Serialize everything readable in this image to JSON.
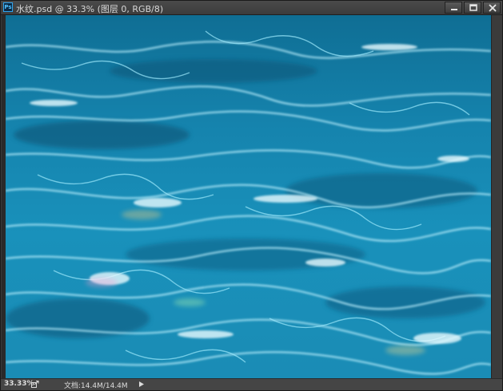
{
  "window": {
    "app_icon_label": "Ps",
    "title": "水纹.psd @ 33.3% (图层 0, RGB/8)"
  },
  "canvas": {
    "image_description_icon": "water-ripple-image"
  },
  "statusbar": {
    "zoom": "33.33%",
    "doc_size": "文档:14.4M/14.4M"
  },
  "colors": {
    "water_deep": "#0d5f86",
    "water_mid": "#1a8fb8",
    "water_light": "#6fd6f0",
    "highlight": "#e8fbff"
  }
}
